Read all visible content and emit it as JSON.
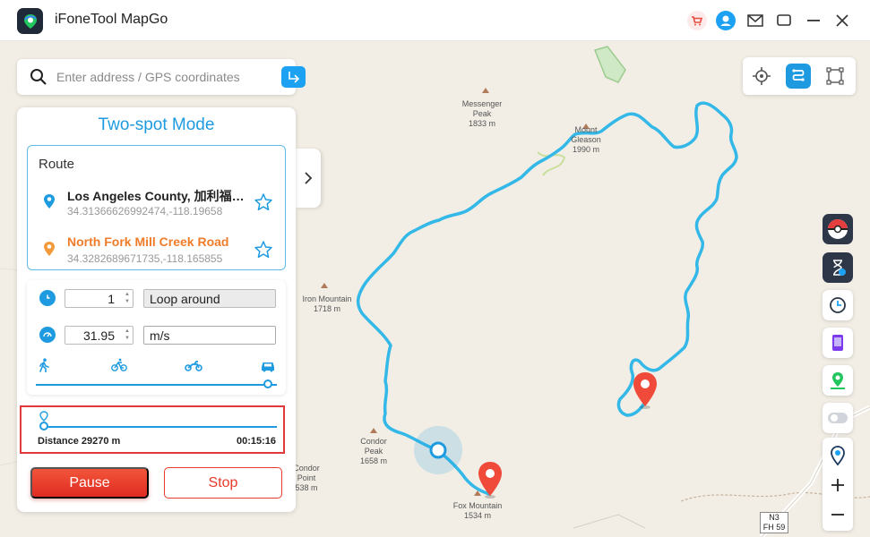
{
  "app": {
    "title": "iFoneTool MapGo"
  },
  "titlebar_icons": [
    "cart-icon",
    "user-icon",
    "mail-icon",
    "maximize-icon",
    "minimize-icon",
    "close-icon"
  ],
  "search": {
    "placeholder": "Enter address / GPS coordinates",
    "value": ""
  },
  "panel": {
    "mode_title": "Two-spot Mode",
    "route_label": "Route",
    "start": {
      "name": "Los Angeles County, 加利福尼亚州",
      "coords": "34.31366626992474,-118.19658"
    },
    "end": {
      "name": "North Fork Mill Creek Road",
      "coords": "34.3282689671735,-118.165855"
    },
    "repeat_count": "1",
    "repeat_mode": "Loop around",
    "speed_value": "31.95",
    "speed_unit": "m/s",
    "speed_slider_level": 0.96,
    "progress_level": 0.02,
    "distance": "Distance 29270 m",
    "time": "00:15:16",
    "pause_label": "Pause",
    "stop_label": "Stop"
  },
  "map_labels": {
    "messenger": [
      "Messenger",
      "Peak",
      "1833 m"
    ],
    "gleason": [
      "Mount",
      "Gleason",
      "1990 m"
    ],
    "iron": [
      "Iron Mountain",
      "1718 m"
    ],
    "condor_peak": [
      "Condor",
      "Peak",
      "1658 m"
    ],
    "condor_point": [
      "Condor",
      "Point",
      "538 m"
    ],
    "fox": [
      "Fox Mountain",
      "1534 m"
    ],
    "road_sign": [
      "N3",
      "FH 59"
    ]
  },
  "colors": {
    "accent": "#1e9be0",
    "route": "#33b8e8",
    "danger": "#e83a2c",
    "highlight_border": "#e03b3b"
  }
}
